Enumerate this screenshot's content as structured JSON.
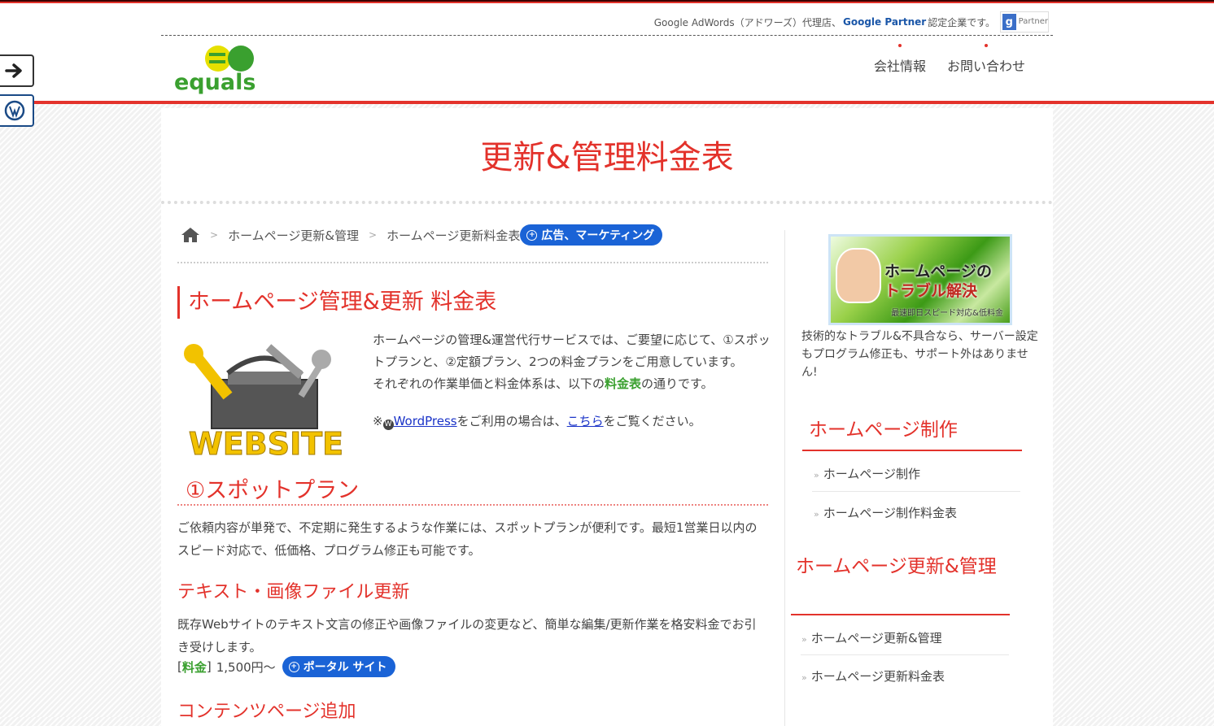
{
  "header": {
    "partner_text_pre": "Google AdWords（アドワーズ）代理店、",
    "partner_strong": "Google Partner",
    "partner_text_post": "認定企業です。",
    "badge_label": "Partner",
    "logo_text": "equals",
    "nav": [
      {
        "label": "会社情報"
      },
      {
        "label": "お問い合わせ"
      }
    ]
  },
  "icons": {
    "side_toggle": "arrow-right-icon",
    "wordpress": "wordpress-icon",
    "home": "home-icon"
  },
  "page": {
    "title": "更新&管理料金表",
    "breadcrumb": [
      "ホームページ更新&管理",
      "ホームページ更新料金表"
    ],
    "pill_ad": "広告、マーケティング",
    "pill_portal": "ポータル サイト"
  },
  "main": {
    "h2": "ホームページ管理&更新 料金表",
    "image_label": "WEBSITE",
    "intro_1": "ホームページの管理&運営代行サービスでは、ご要望に応じて、①スポットプランと、②定額プラン、2つの料金プランをご用意しています。",
    "intro_2_pre": "それぞれの作業単価と料金体系は、以下の",
    "intro_2_green": "料金表",
    "intro_2_post": "の通りです。",
    "note_pre": "※",
    "note_link1": "WordPress",
    "note_mid": "をご利用の場合は、",
    "note_link2": "こちら",
    "note_post": "をご覧ください。",
    "h3_spot": "①スポットプラン",
    "spot_text": "ご依頼内容が単発で、不定期に発生するような作業には、スポットプランが便利です。最短1営業日以内のスピード対応で、低価格、プログラム修正も可能です。",
    "h4_text_update": "テキスト・画像ファイル更新",
    "text_update_desc": "既存Webサイトのテキスト文言の修正や画像ファイルの変更など、簡単な編集/更新作業を格安料金でお引き受けします。",
    "price_open": "[",
    "price_label": "料金",
    "price_close": "]",
    "price_value": "1,500円～",
    "h4_contents": "コンテンツページ追加"
  },
  "sidebar": {
    "banner_line1": "ホームページの",
    "banner_line2": "トラブル解決",
    "banner_line3": "最速即日スピード対応&低料金",
    "text": "技術的なトラブル&不具合なら、サーバー設定もプログラム修正も、サポート外はありません!",
    "section1_title": "ホームページ制作",
    "section1_items": [
      "ホームページ制作",
      "ホームページ制作料金表"
    ],
    "section2_title": "ホームページ更新&管理",
    "section2_items": [
      "ホームページ更新&管理",
      "ホームページ更新料金表"
    ]
  },
  "colors": {
    "accent": "#e3322b",
    "pill_blue": "#1a63d6",
    "green": "#3aa02f"
  }
}
